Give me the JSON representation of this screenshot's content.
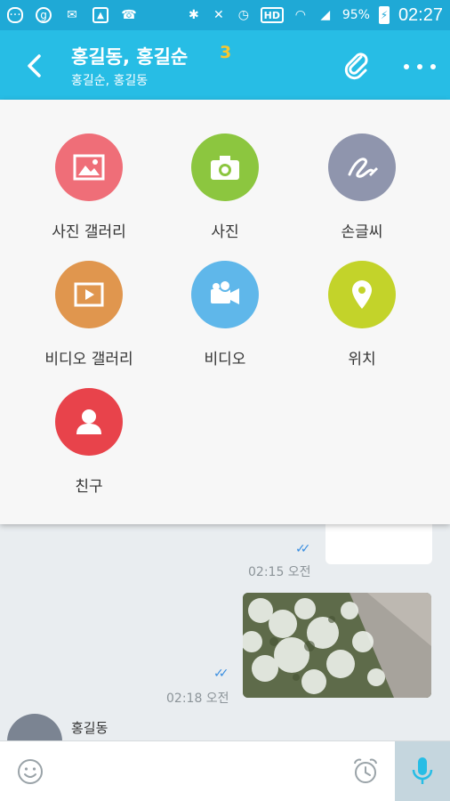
{
  "status_bar": {
    "battery_percent": "95%",
    "time": "02:27",
    "hd_label": "HD"
  },
  "header": {
    "title": "홍길동, 홍길순",
    "participant_count": "3",
    "subtitle": "홍길순, 홍길동"
  },
  "attach_menu": {
    "items": [
      {
        "label": "사진 갤러리",
        "icon": "gallery-icon",
        "color": "#ef6e78"
      },
      {
        "label": "사진",
        "icon": "camera-icon",
        "color": "#8cc63f"
      },
      {
        "label": "손글씨",
        "icon": "handwriting-icon",
        "color": "#8f95ad"
      },
      {
        "label": "비디오 갤러리",
        "icon": "video-gallery-icon",
        "color": "#e0964e"
      },
      {
        "label": "비디오",
        "icon": "video-camera-icon",
        "color": "#5fb7ea"
      },
      {
        "label": "위치",
        "icon": "location-pin-icon",
        "color": "#c3d32a"
      },
      {
        "label": "친구",
        "icon": "friend-icon",
        "color": "#e8434b"
      }
    ]
  },
  "messages": [
    {
      "time": "02:15 오전"
    },
    {
      "time": "02:18 오전"
    }
  ],
  "incoming": {
    "sender": "홍길동"
  },
  "colors": {
    "status_bar": "#1fa9d6",
    "app_bar": "#27bde5",
    "count": "#f7c631",
    "read_check": "#3a8ee0",
    "mic": "#27bde5"
  }
}
